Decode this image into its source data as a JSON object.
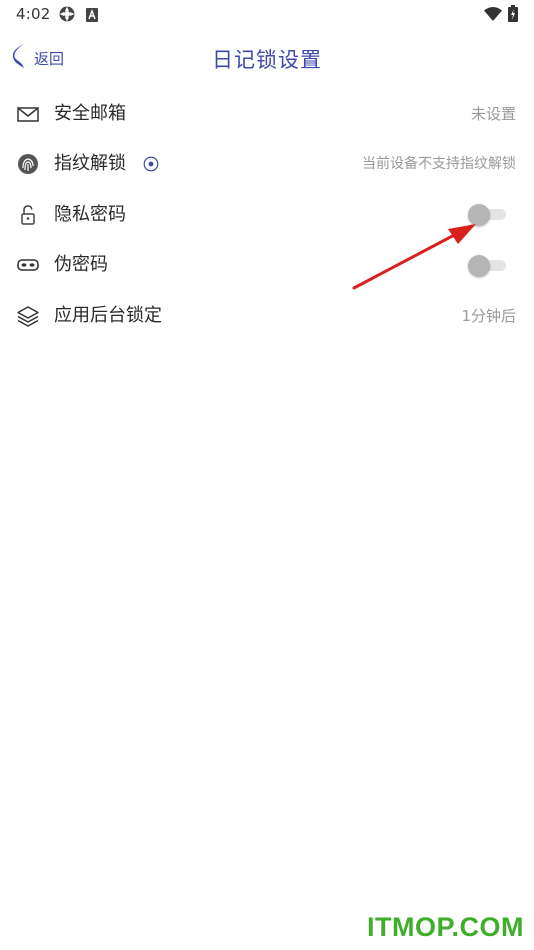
{
  "status_bar": {
    "time": "4:02"
  },
  "nav": {
    "back_label": "返回",
    "title": "日记锁设置"
  },
  "rows": [
    {
      "label": "安全邮箱",
      "value": "未设置",
      "icon": "mail-icon"
    },
    {
      "label": "指纹解锁",
      "value": "当前设备不支持指纹解锁",
      "icon": "fingerprint-icon",
      "info_icon": "info-circle-icon"
    },
    {
      "label": "隐私密码",
      "icon": "unlock-icon",
      "toggle": false
    },
    {
      "label": "伪密码",
      "icon": "mask-icon",
      "toggle": false
    },
    {
      "label": "应用后台锁定",
      "value": "1分钟后",
      "icon": "layers-icon"
    }
  ],
  "colors": {
    "accent": "#3d4aa8",
    "toggle_off_thumb": "#b5b5b5",
    "toggle_off_track": "#e4e4e4",
    "annotation_arrow": "#d8201c",
    "watermark": "#3fae2a"
  },
  "watermark": "ITMOP.COM"
}
